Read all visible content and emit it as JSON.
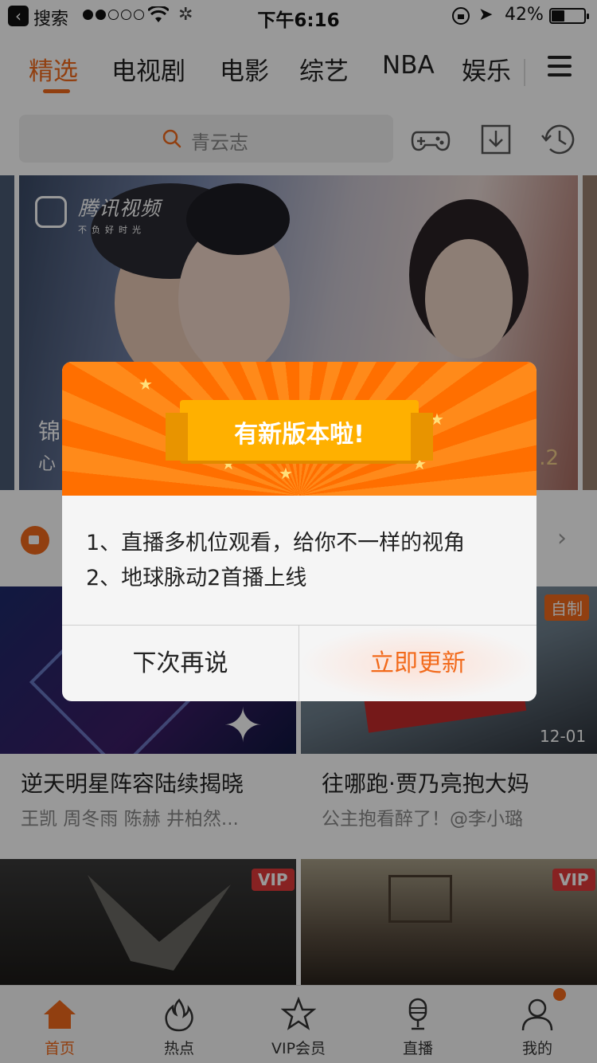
{
  "status_bar": {
    "back_label": "搜索",
    "time": "下午6:16",
    "battery": "42%"
  },
  "tabs": [
    {
      "label": "精选",
      "active": true
    },
    {
      "label": "电视剧"
    },
    {
      "label": "电影"
    },
    {
      "label": "综艺"
    },
    {
      "label": "NBA"
    },
    {
      "label": "娱乐"
    }
  ],
  "search": {
    "placeholder": "青云志"
  },
  "top_icons": [
    "gamepad-icon",
    "download-icon",
    "history-icon"
  ],
  "banner": {
    "logo_brand": "腾讯视频",
    "logo_slogan": "不负好时光",
    "caption_title": "锦",
    "caption_sub": "心",
    "episode_fragment": ".2"
  },
  "cards": [
    {
      "title": "逆天明星阵容陆续揭晓",
      "subtitle": "王凯 周冬雨 陈赫 井柏然...",
      "badge": ""
    },
    {
      "title": "往哪跑·贾乃亮抱大妈",
      "subtitle": "公主抱看醉了！@李小璐",
      "badge": "自制",
      "date": "12-01"
    },
    {
      "badge": "VIP"
    },
    {
      "badge": "VIP"
    }
  ],
  "bottom_nav": [
    {
      "label": "首页",
      "icon": "home-icon",
      "active": true
    },
    {
      "label": "热点",
      "icon": "flame-icon"
    },
    {
      "label": "VIP会员",
      "icon": "star-icon"
    },
    {
      "label": "直播",
      "icon": "microphone-icon"
    },
    {
      "label": "我的",
      "icon": "user-icon"
    }
  ],
  "dialog": {
    "title": "有新版本啦!",
    "lines": [
      "1、直播多机位观看，给你不一样的视角",
      "2、地球脉动2首播上线"
    ],
    "later_label": "下次再说",
    "update_label": "立即更新"
  },
  "colors": {
    "accent": "#f26a1b",
    "vip": "#e23a3a"
  }
}
